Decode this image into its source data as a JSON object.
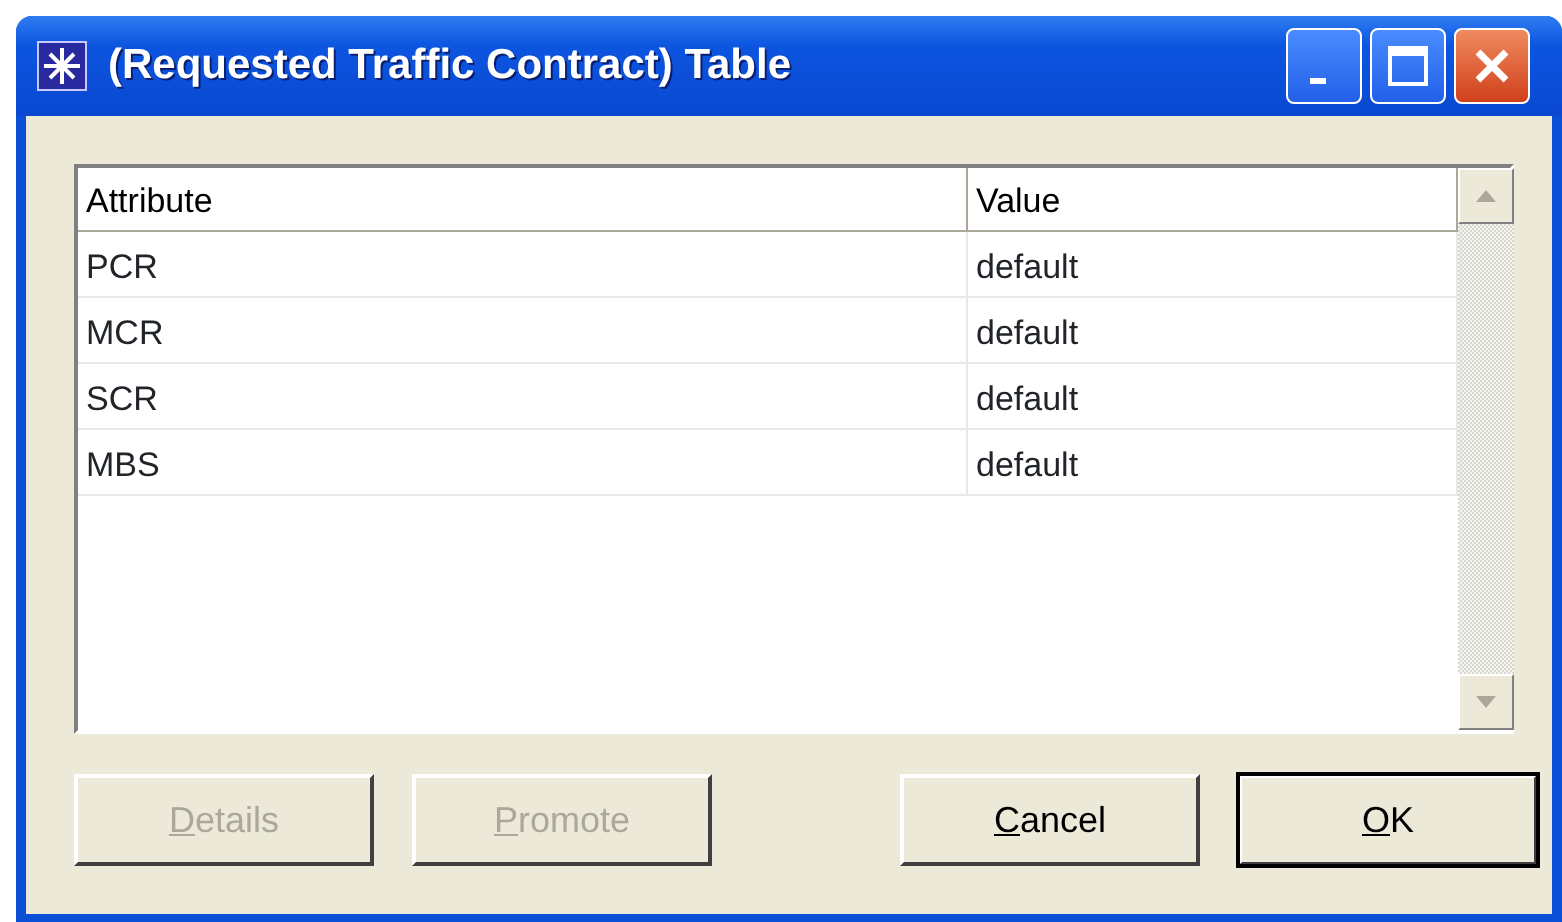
{
  "window": {
    "title": "(Requested Traffic Contract) Table"
  },
  "table": {
    "columns": [
      "Attribute",
      "Value"
    ],
    "rows": [
      [
        "PCR",
        "default"
      ],
      [
        "MCR",
        "default"
      ],
      [
        "SCR",
        "default"
      ],
      [
        "MBS",
        "default"
      ]
    ]
  },
  "buttons": [
    {
      "label": "Details",
      "disabled": true,
      "default": false,
      "underline_first": true
    },
    {
      "label": "Promote",
      "disabled": true,
      "default": false,
      "underline_first": true
    },
    {
      "label": "Cancel",
      "disabled": false,
      "default": false,
      "underline_first": true
    },
    {
      "label": "OK",
      "disabled": false,
      "default": true,
      "underline_first": true
    }
  ]
}
